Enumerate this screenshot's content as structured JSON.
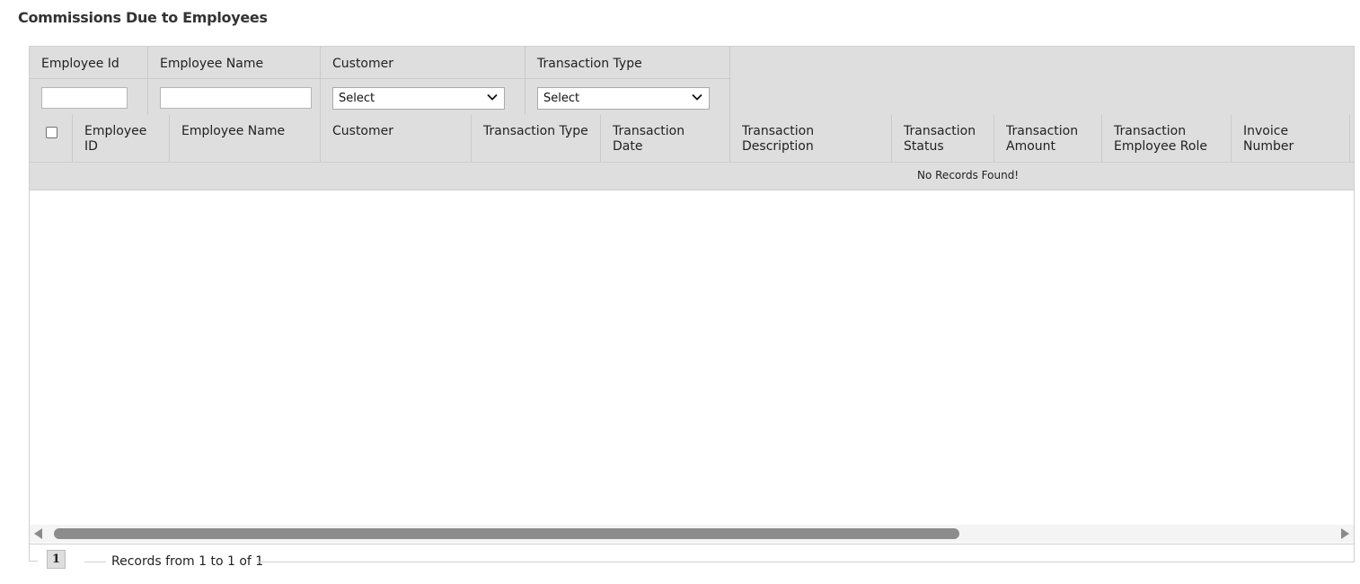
{
  "page": {
    "title": "Commissions Due to Employees"
  },
  "filters": {
    "employee_id": {
      "label": "Employee Id",
      "value": ""
    },
    "employee_name": {
      "label": "Employee Name",
      "value": ""
    },
    "customer": {
      "label": "Customer",
      "selected": "Select"
    },
    "transaction_type": {
      "label": "Transaction Type",
      "selected": "Select"
    }
  },
  "table": {
    "columns": [
      "Employee ID",
      "Employee Name",
      "Customer",
      "Transaction Type",
      "Transaction Date",
      "Transaction Description",
      "Transaction Status",
      "Transaction Amount",
      "Transaction Employee Role",
      "Invoice Number"
    ],
    "empty_message": "No Records Found!"
  },
  "pager": {
    "current_page": "1",
    "summary": "Records from 1 to 1 of 1"
  },
  "colors": {
    "header_bg": "#dedede",
    "border": "#cfcfcf",
    "scroll_thumb": "#8c8c8c"
  }
}
